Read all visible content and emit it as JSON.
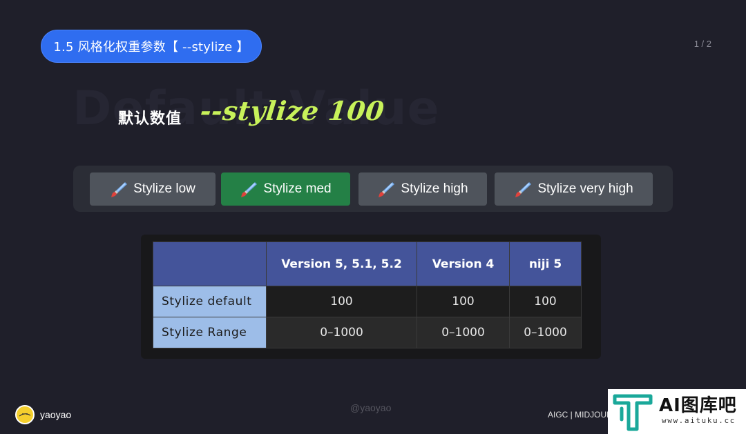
{
  "header": {
    "section_pill": "1.5 风格化权重参数【 --stylize 】",
    "page_indicator": "1 / 2"
  },
  "hero": {
    "watermark": "Default Value",
    "label": "默认数值",
    "value": "--stylize 100",
    "value_color": "#c8f25a"
  },
  "buttons": [
    {
      "label": "Stylize low",
      "icon": "paintbrush-icon",
      "active": false
    },
    {
      "label": "Stylize med",
      "icon": "paintbrush-icon",
      "active": true
    },
    {
      "label": "Stylize high",
      "icon": "paintbrush-icon",
      "active": false
    },
    {
      "label": "Stylize very high",
      "icon": "paintbrush-icon",
      "active": false
    }
  ],
  "table": {
    "columns": [
      "",
      "Version 5, 5.1, 5.2",
      "Version 4",
      "niji 5"
    ],
    "rows": [
      {
        "label": "Stylize default",
        "values": [
          "100",
          "100",
          "100"
        ]
      },
      {
        "label": "Stylize Range",
        "values": [
          "0–1000",
          "0–1000",
          "0–1000"
        ]
      }
    ]
  },
  "footer": {
    "author": "yaoyao",
    "center_watermark": "@yaoyao",
    "right_text": "AIGC | MIDJOURNEY"
  },
  "logo": {
    "text": "AI图库吧",
    "url": "www.aituku.cc",
    "brand_color": "#1aa89a"
  },
  "colors": {
    "background": "#1f1f2a",
    "pill": "#2f6df0",
    "active_button": "#248046",
    "inactive_button": "#4f545c",
    "table_header": "#44549a",
    "table_row_head": "#9dbde8"
  }
}
